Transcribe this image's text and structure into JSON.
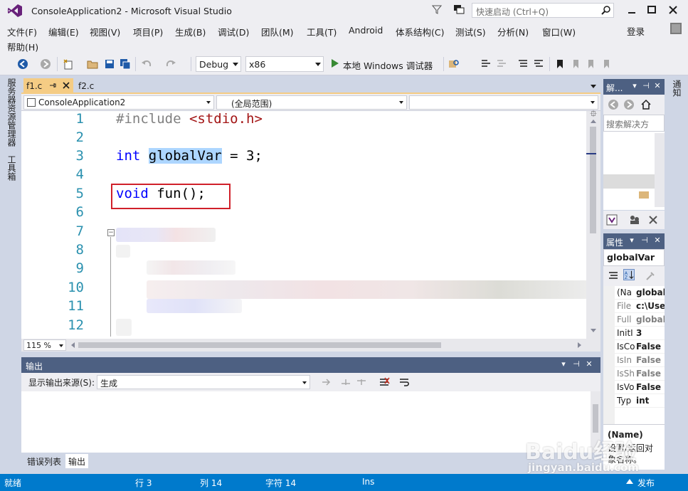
{
  "window": {
    "title": "ConsoleApplication2 - Microsoft Visual Studio",
    "quick_launch_placeholder": "快速启动 (Ctrl+Q)"
  },
  "menu": {
    "items": [
      "文件(F)",
      "编辑(E)",
      "视图(V)",
      "项目(P)",
      "生成(B)",
      "调试(D)",
      "团队(M)",
      "工具(T)",
      "Android",
      "体系结构(C)",
      "测试(S)",
      "分析(N)",
      "窗口(W)",
      "帮助(H)"
    ],
    "login": "登录"
  },
  "toolbar": {
    "configuration": "Debug",
    "platform": "x86",
    "run_label": "本地 Windows 调试器"
  },
  "left_strip": {
    "server_explorer": "服务器资源管理器",
    "toolbox": "工具箱"
  },
  "right_strip": {
    "notifications": "通知"
  },
  "editor": {
    "tabs": [
      {
        "label": "f1.c"
      },
      {
        "label": "f2.c"
      }
    ],
    "nav": {
      "project": "ConsoleApplication2",
      "scope": "(全局范围)"
    },
    "line_numbers": [
      "1",
      "2",
      "3",
      "4",
      "5",
      "6",
      "7",
      "8",
      "9",
      "10",
      "11",
      "12"
    ],
    "code": {
      "line1_directive": "#include",
      "line1_header": "<stdio.h>",
      "line3_type": "int",
      "line3_var": "globalVar",
      "line3_rest": " = 3;",
      "line5_type": "void",
      "line5_rest": " fun();"
    },
    "collapse_glyph": "−",
    "split_glyph": "⯐",
    "zoom": "115 %"
  },
  "output": {
    "title": "输出",
    "source_label": "显示输出来源(S):",
    "source_value": "生成"
  },
  "bottom_tabs": [
    "错误列表",
    "输出"
  ],
  "solution_explorer": {
    "title": "解...",
    "search_placeholder": "搜索解决方"
  },
  "properties": {
    "title": "属性",
    "object": "globalVar",
    "rows": [
      {
        "name": "(Na",
        "value": "global",
        "dim": false,
        "selected": true
      },
      {
        "name": "File",
        "value": "c:\\User",
        "dim": true
      },
      {
        "name": "Full",
        "value": "global",
        "dim": true
      },
      {
        "name": "InitI",
        "value": "3",
        "dim": false
      },
      {
        "name": "IsCo",
        "value": "False",
        "dim": false
      },
      {
        "name": "IsIn",
        "value": "False",
        "dim": true
      },
      {
        "name": "IsSh",
        "value": "False",
        "dim": true
      },
      {
        "name": "IsVo",
        "value": "False",
        "dim": false
      },
      {
        "name": "Typ",
        "value": "int",
        "dim": false
      }
    ],
    "desc_name": "(Name)",
    "desc_text": "设置/返回对象名称。"
  },
  "statusbar": {
    "ready": "就绪",
    "line": "行 3",
    "col": "列 14",
    "char": "字符 14",
    "mode": "Ins",
    "publish": "发布"
  },
  "watermark": {
    "brand": "Baidu经验",
    "url": "jingyan.baidu.com"
  },
  "colors": {
    "accent": "#007acc",
    "panel_title": "#4d6082",
    "highlight_box": "#d0202a",
    "tab_active": "#f5cc84"
  }
}
